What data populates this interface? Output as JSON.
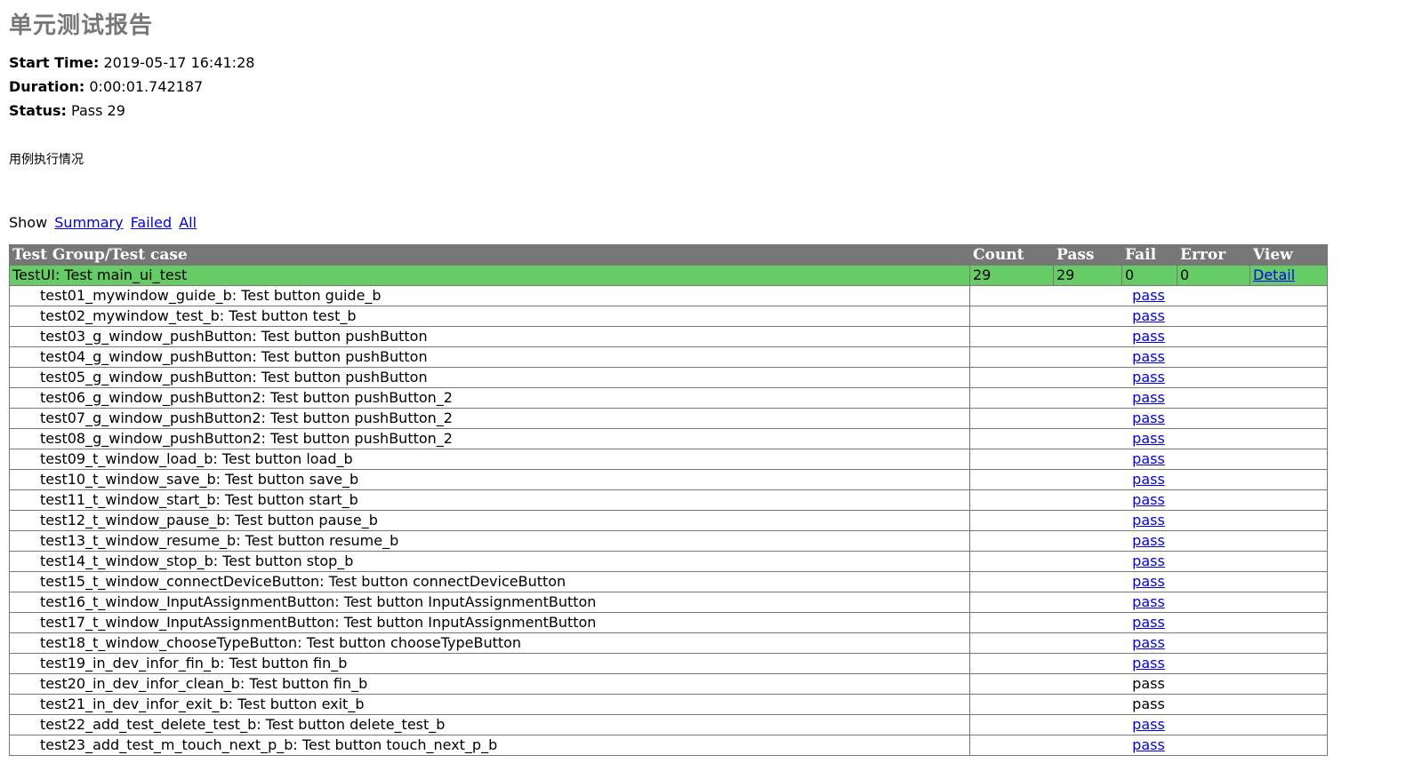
{
  "report": {
    "title": "单元测试报告"
  },
  "attributes": {
    "start_time_label": "Start Time:",
    "start_time_value": "2019-05-17 16:41:28",
    "duration_label": "Duration:",
    "duration_value": "0:00:01.742187",
    "status_label": "Status:",
    "status_value": "Pass 29"
  },
  "description": "用例执行情况",
  "show": {
    "label": "Show",
    "summary": "Summary",
    "failed": "Failed",
    "all": "All"
  },
  "table": {
    "headers": {
      "group": "Test Group/Test case",
      "count": "Count",
      "pass": "Pass",
      "fail": "Fail",
      "error": "Error",
      "view": "View"
    },
    "group": {
      "name": "TestUI: Test main_ui_test",
      "count": "29",
      "pass": "29",
      "fail": "0",
      "error": "0",
      "view": "Detail"
    },
    "cases": [
      {
        "name": "test01_mywindow_guide_b: Test button guide_b",
        "status": "pass",
        "link": true
      },
      {
        "name": "test02_mywindow_test_b: Test button test_b",
        "status": "pass",
        "link": true
      },
      {
        "name": "test03_g_window_pushButton: Test button pushButton",
        "status": "pass",
        "link": true
      },
      {
        "name": "test04_g_window_pushButton: Test button pushButton",
        "status": "pass",
        "link": true
      },
      {
        "name": "test05_g_window_pushButton: Test button pushButton",
        "status": "pass",
        "link": true
      },
      {
        "name": "test06_g_window_pushButton2: Test button pushButton_2",
        "status": "pass",
        "link": true
      },
      {
        "name": "test07_g_window_pushButton2: Test button pushButton_2",
        "status": "pass",
        "link": true
      },
      {
        "name": "test08_g_window_pushButton2: Test button pushButton_2",
        "status": "pass",
        "link": true
      },
      {
        "name": "test09_t_window_load_b: Test button load_b",
        "status": "pass",
        "link": true
      },
      {
        "name": "test10_t_window_save_b: Test button save_b",
        "status": "pass",
        "link": true
      },
      {
        "name": "test11_t_window_start_b: Test button start_b",
        "status": "pass",
        "link": true
      },
      {
        "name": "test12_t_window_pause_b: Test button pause_b",
        "status": "pass",
        "link": true
      },
      {
        "name": "test13_t_window_resume_b: Test button resume_b",
        "status": "pass",
        "link": true
      },
      {
        "name": "test14_t_window_stop_b: Test button stop_b",
        "status": "pass",
        "link": true
      },
      {
        "name": "test15_t_window_connectDeviceButton: Test button connectDeviceButton",
        "status": "pass",
        "link": true
      },
      {
        "name": "test16_t_window_InputAssignmentButton: Test button InputAssignmentButton",
        "status": "pass",
        "link": true
      },
      {
        "name": "test17_t_window_InputAssignmentButton: Test button InputAssignmentButton",
        "status": "pass",
        "link": true
      },
      {
        "name": "test18_t_window_chooseTypeButton: Test button chooseTypeButton",
        "status": "pass",
        "link": true
      },
      {
        "name": "test19_in_dev_infor_fin_b: Test button fin_b",
        "status": "pass",
        "link": true
      },
      {
        "name": "test20_in_dev_infor_clean_b: Test button fin_b",
        "status": "pass",
        "link": false
      },
      {
        "name": "test21_in_dev_infor_exit_b: Test button exit_b",
        "status": "pass",
        "link": false
      },
      {
        "name": "test22_add_test_delete_test_b: Test button delete_test_b",
        "status": "pass",
        "link": true
      },
      {
        "name": "test23_add_test_m_touch_next_p_b: Test button touch_next_p_b",
        "status": "pass",
        "link": true
      }
    ]
  },
  "colors": {
    "title": "#777777",
    "header_bg": "#777777",
    "header_text": "#ffffff",
    "group_bg": "#66cc66",
    "link": "#0000ee",
    "border": "#777777"
  }
}
